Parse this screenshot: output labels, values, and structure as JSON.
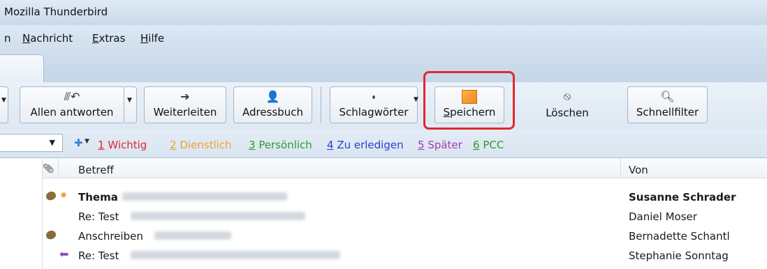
{
  "window": {
    "title": "Mozilla Thunderbird"
  },
  "menu": {
    "items": [
      {
        "label": "n",
        "underline": ""
      },
      {
        "label": "achricht",
        "underline": "N"
      },
      {
        "label": "xtras",
        "underline": "E"
      },
      {
        "label": "ilfe",
        "underline": "H"
      }
    ]
  },
  "toolbar": {
    "reply_all": {
      "label": "Allen antworten",
      "icon": "reply-all-icon"
    },
    "forward": {
      "label": "Weiterleiten",
      "icon": "forward-icon"
    },
    "address_book": {
      "label": "Adressbuch",
      "icon": "address-book-icon"
    },
    "tags": {
      "label": "Schlagwörter",
      "icon": "tag-icon"
    },
    "save": {
      "label_underline": "S",
      "label_rest": "peichern",
      "icon": "save-icon"
    },
    "delete": {
      "label": "Löschen",
      "icon": "delete-icon"
    },
    "quick_filter": {
      "label": "Schnellfilter",
      "icon": "search-icon"
    },
    "highlight_color": "#e0282e"
  },
  "tags": [
    {
      "num": "1",
      "label": " Wichtig",
      "color": "#e0282e"
    },
    {
      "num": "2",
      "label": " Dienstlich",
      "color": "#f0a030"
    },
    {
      "num": "3",
      "label": " Persönlich",
      "color": "#2e9a2e"
    },
    {
      "num": "4",
      "label": " Zu erledigen",
      "color": "#2a3fcf"
    },
    {
      "num": "5",
      "label": " Später",
      "color": "#a03ab0"
    },
    {
      "num": "6",
      "label": " PCC",
      "color": "#2e9a2e"
    }
  ],
  "message_list": {
    "columns": {
      "subject": "Betreff",
      "from": "Von"
    },
    "rows": [
      {
        "subject": "Thema",
        "from": "Susanne Schrader",
        "bold": true,
        "attachment": true,
        "starred": true,
        "replied": false
      },
      {
        "subject": "Re: Test",
        "from": "Daniel Moser",
        "bold": false,
        "attachment": false,
        "starred": false,
        "replied": false
      },
      {
        "subject": "Anschreiben",
        "from": "Bernadette Schantl",
        "bold": false,
        "attachment": true,
        "starred": false,
        "replied": false
      },
      {
        "subject": "Re: Test",
        "from": "Stephanie Sonntag",
        "bold": false,
        "attachment": false,
        "starred": false,
        "replied": true
      }
    ]
  }
}
